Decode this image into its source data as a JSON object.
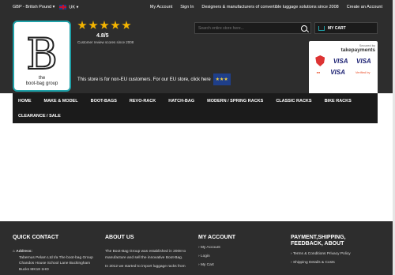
{
  "topbar": {
    "currency": "GBP - British Pound",
    "country": "UK",
    "my_account": "My Account",
    "sign_in": "Sign In",
    "tagline": "Designers & manufacturers of convertible luggage solutions since 2008",
    "create_account": "Create an Account"
  },
  "logo": {
    "letter": "B",
    "line1": "the",
    "line2": "boot-bag group"
  },
  "rating": {
    "stars": 5,
    "score": "4.8/5",
    "caption": "Customer review scores since 2008"
  },
  "notice": {
    "text": "This store is for non-EU customers. For our EU store, click here"
  },
  "search": {
    "placeholder": "Search entire store here..."
  },
  "cart": {
    "label": "MY CART"
  },
  "trust": {
    "secured_by": "Secured by",
    "brand": "takepayments",
    "visa_label": "VISA",
    "verified_by": "Verified by"
  },
  "nav": {
    "row1": [
      "HOME",
      "MAKE & MODEL",
      "BOOT-BAGS",
      "REVO-RACK",
      "HATCH-BAG",
      "MODERN / SPRING RACKS",
      "CLASSIC RACKS",
      "BIKE RACKS"
    ],
    "row2": [
      "CLEARANCE / SALE"
    ]
  },
  "footer": {
    "quick_contact": {
      "title": "QUICK CONTACT",
      "address_label": "Address:",
      "address": "Tabernus Pelam Ltd t/a The boot-bag Group Chandos House School Lane Buckingham Bucks MK18 1HD"
    },
    "about": {
      "title": "ABOUT US",
      "p1": "The Boot-Bag Group was established in 2008 to manufacture and sell the innovative Boot-Bag.",
      "p2": "In 2012 we started to import luggage racks from"
    },
    "my_account": {
      "title": "MY ACCOUNT",
      "links": [
        "My Account",
        "Login",
        "My Cart"
      ]
    },
    "payment": {
      "title": "PAYMENT,SHIPPING, FEEDBACK, ABOUT",
      "links": [
        "Terms & Conditions Privacy Policy",
        "Shipping Details & Costs"
      ]
    }
  }
}
